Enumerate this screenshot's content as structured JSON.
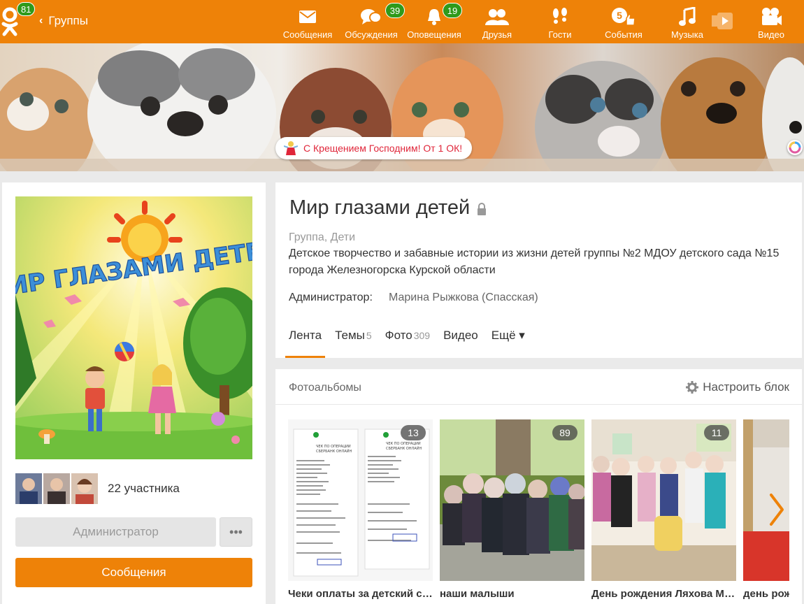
{
  "header": {
    "logo_badge": "81",
    "back_label": "Группы",
    "nav": [
      {
        "label": "Сообщения",
        "icon": "envelope-icon",
        "badge": ""
      },
      {
        "label": "Обсуждения",
        "icon": "chat-bubbles-icon",
        "badge": "39"
      },
      {
        "label": "Оповещения",
        "icon": "bell-icon",
        "badge": "19"
      },
      {
        "label": "Друзья",
        "icon": "friends-icon",
        "badge": ""
      },
      {
        "label": "Гости",
        "icon": "footprints-icon",
        "badge": ""
      },
      {
        "label": "События",
        "icon": "events-icon",
        "badge": ""
      },
      {
        "label": "Музыка",
        "icon": "music-note-icon",
        "badge": ""
      },
      {
        "label": "Видео",
        "icon": "video-camera-icon",
        "badge": ""
      }
    ]
  },
  "cover": {
    "holiday_text": "С Крещением Господним! От 1 ОК!"
  },
  "group": {
    "title": "Мир глазами детей",
    "category": "Группа, Дети",
    "description": "Детское творчество и забавные истории из жизни детей группы №2 МДОУ детского сада №15 города Железногорска Курской области",
    "admin_label": "Администратор:",
    "admin_name": "Марина Рыжкова (Спасская)",
    "avatar_text": "МИР ГЛАЗАМИ ДЕТЕЙ",
    "members_count": "22 участника",
    "btn_admin": "Администратор",
    "btn_more": "•••",
    "btn_messages": "Сообщения",
    "tabs": [
      {
        "label": "Лента",
        "count": ""
      },
      {
        "label": "Темы",
        "count": "5"
      },
      {
        "label": "Фото",
        "count": "309"
      },
      {
        "label": "Видео",
        "count": ""
      },
      {
        "label": "Ещё ▾",
        "count": ""
      }
    ]
  },
  "albums": {
    "title": "Фотоальбомы",
    "setup_label": "Настроить блок",
    "items": [
      {
        "name": "Чеки оплаты за детский сад",
        "count": "13"
      },
      {
        "name": "наши малыши",
        "count": "89"
      },
      {
        "name": "День рождения Ляхова Ма...",
        "count": "11"
      },
      {
        "name": "день рож",
        "count": ""
      }
    ],
    "receipt_head": "ЧЕК ПО ОПЕРАЦИИ",
    "receipt_sub": "СБЕРБАНК ОНЛАЙН"
  },
  "colors": {
    "brand": "#ee8208",
    "badge": "#2f9a1b",
    "holiday": "#e0263a"
  }
}
